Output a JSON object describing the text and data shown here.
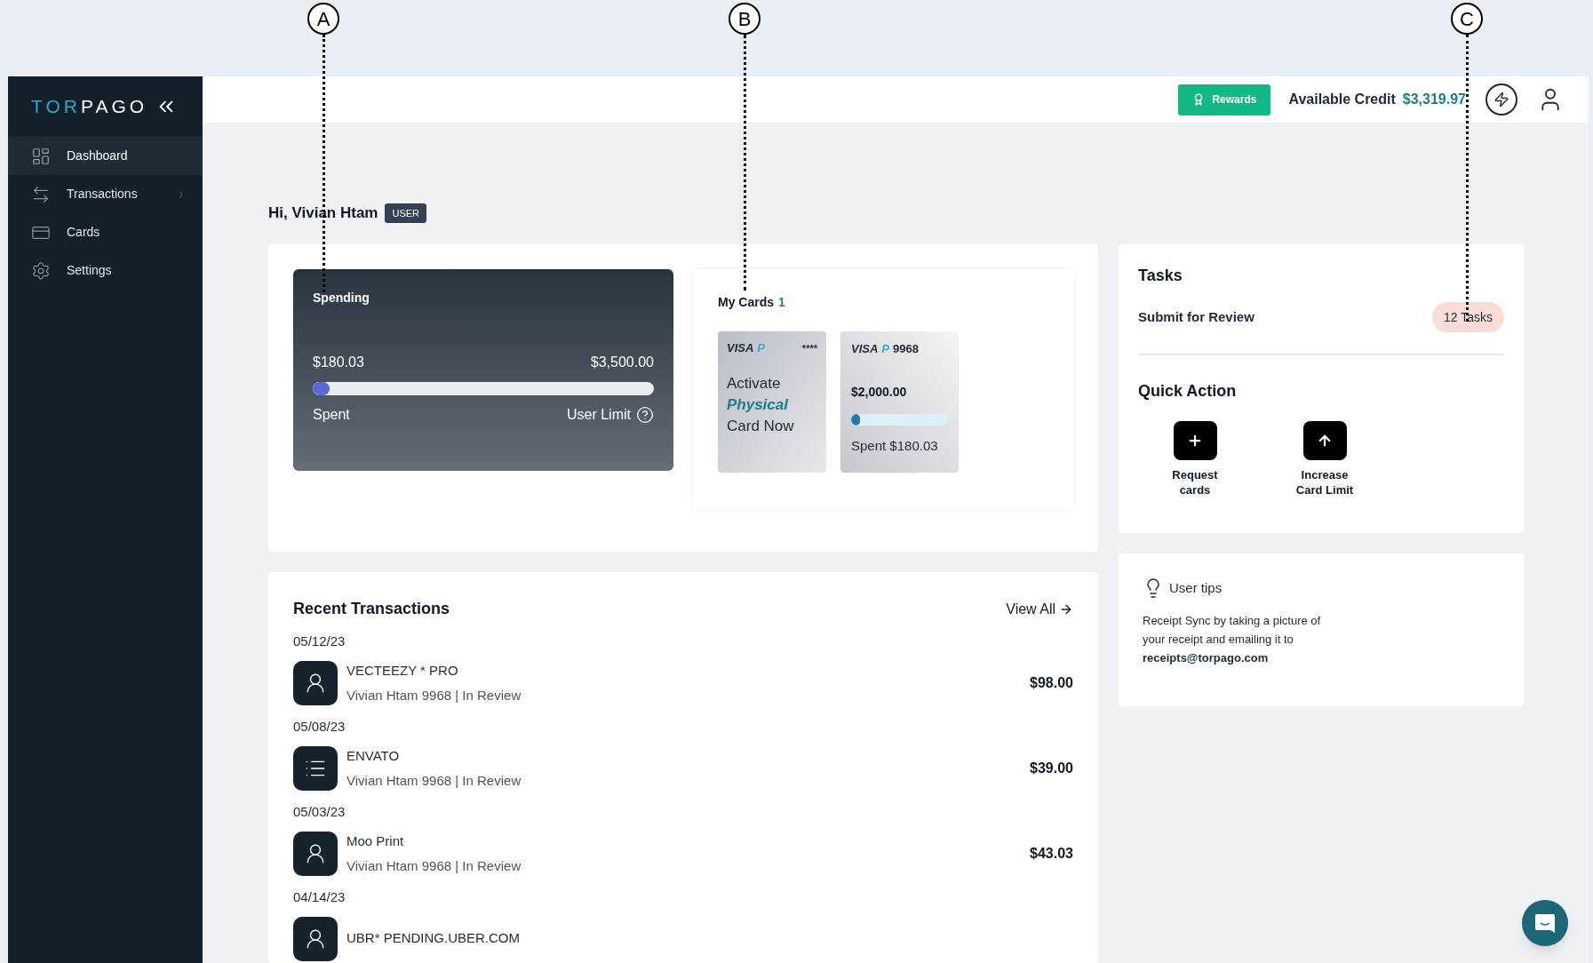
{
  "annotations": [
    {
      "label": "A"
    },
    {
      "label": "B"
    },
    {
      "label": "C"
    }
  ],
  "sidebar": {
    "logo": {
      "accent": "TOR",
      "rest": "PAGO"
    },
    "items": [
      {
        "label": "Dashboard",
        "selected": true,
        "has_submenu": false
      },
      {
        "label": "Transactions",
        "selected": false,
        "has_submenu": true
      },
      {
        "label": "Cards",
        "selected": false,
        "has_submenu": false
      },
      {
        "label": "Settings",
        "selected": false,
        "has_submenu": false
      }
    ]
  },
  "header": {
    "rewards_button": "Rewards",
    "credit_label": "Available Credit",
    "credit_value": "$3,319.97"
  },
  "greeting": {
    "text": "Hi, Vivian Htam",
    "role_badge": "USER"
  },
  "spending": {
    "title": "Spending",
    "spent_amount": "$180.03",
    "limit_amount": "$3,500.00",
    "level": 0.05,
    "spent_label": "Spent",
    "limit_label": "User Limit"
  },
  "my_cards": {
    "title": "My Cards",
    "count": "1",
    "cards": [
      {
        "kind": "activate",
        "brand": "VISA",
        "mark": "P",
        "number": "****",
        "line1": "Activate",
        "highlight": "Physical",
        "line2": "Card Now"
      },
      {
        "kind": "card",
        "brand": "VISA",
        "mark": "P",
        "number": "9968",
        "amount": "$2,000.00",
        "level": 0.09,
        "spent": "Spent $180.03"
      }
    ]
  },
  "tasks": {
    "title": "Tasks",
    "items": [
      {
        "label": "Submit for Review",
        "count": "12 Tasks"
      }
    ]
  },
  "quick_action": {
    "title": "Quick Action",
    "actions": [
      {
        "label": "Request cards"
      },
      {
        "label": "Increase Card Limit"
      }
    ]
  },
  "tips": {
    "title": "User tips",
    "text": "Receipt Sync by taking a picture of your receipt and emailing it to **receipts@torpago.com**"
  },
  "transactions": {
    "title": "Recent Transactions",
    "view_all": "View All",
    "groups": [
      {
        "date": "05/12/23",
        "merchant": "VECTEEZY * PRO",
        "detail": "Vivian Htam 9968 | In Review",
        "amount": "$98.00",
        "kind": "person"
      },
      {
        "date": "05/08/23",
        "merchant": "ENVATO",
        "detail": "Vivian Htam 9968 | In Review",
        "amount": "$39.00",
        "kind": "list"
      },
      {
        "date": "05/03/23",
        "merchant": "Moo Print",
        "detail": "Vivian Htam 9968 | In Review",
        "amount": "$43.03",
        "kind": "person"
      },
      {
        "date": "04/14/23",
        "merchant": "UBR* PENDING.UBER.COM",
        "kind": "person"
      }
    ]
  }
}
